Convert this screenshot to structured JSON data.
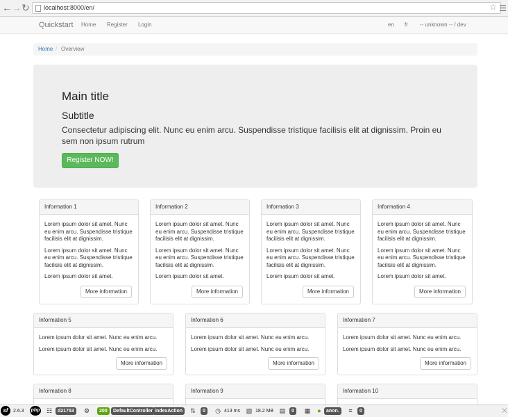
{
  "browser": {
    "url": "localhost:8000/en/"
  },
  "navbar": {
    "brand": "Quickstart",
    "links": [
      "Home",
      "Register",
      "Login"
    ],
    "lang_en": "en",
    "lang_fr": "fr",
    "user_info": "-- unknown -- / dev"
  },
  "breadcrumb": {
    "home": "Home",
    "separator": "/",
    "current": "Overview"
  },
  "jumbotron": {
    "title": "Main title",
    "subtitle": "Subtitle",
    "lead": "Consectetur adipiscing elit. Nunc eu enim arcu. Suspendisse tristique facilisis elit at dignissim. Proin eu sem non ipsum rutrum",
    "button": "Register NOW!"
  },
  "panels": [
    {
      "title": "Information 1",
      "paragraphs": [
        "Lorem ipsum dolor sit amet. Nunc eu enim arcu. Suspendisse tristique facilisis elit at dignissim.",
        "Lorem ipsum dolor sit amet. Nunc eu enim arcu. Suspendisse tristique facilisis elit at dignissim.",
        "Lorem ipsum dolor sit amet."
      ],
      "button": "More information"
    },
    {
      "title": "Information 2",
      "paragraphs": [
        "Lorem ipsum dolor sit amet. Nunc eu enim arcu. Suspendisse tristique facilisis elit at dignissim.",
        "Lorem ipsum dolor sit amet. Nunc eu enim arcu. Suspendisse tristique facilisis elit at dignissim.",
        "Lorem ipsum dolor sit amet."
      ],
      "button": "More information"
    },
    {
      "title": "Information 3",
      "paragraphs": [
        "Lorem ipsum dolor sit amet. Nunc eu enim arcu. Suspendisse tristique facilisis elit at dignissim.",
        "Lorem ipsum dolor sit amet. Nunc eu enim arcu. Suspendisse tristique facilisis elit at dignissim.",
        "Lorem ipsum dolor sit amet."
      ],
      "button": "More information"
    },
    {
      "title": "Information 4",
      "paragraphs": [
        "Lorem ipsum dolor sit amet. Nunc eu enim arcu. Suspendisse tristique facilisis elit at dignissim.",
        "Lorem ipsum dolor sit amet. Nunc eu enim arcu. Suspendisse tristique facilisis elit at dignissim.",
        "Lorem ipsum dolor sit amet."
      ],
      "button": "More information"
    },
    {
      "title": "Information 5",
      "paragraphs": [
        "Lorem ipsum dolor sit amet. Nunc eu enim arcu.",
        "Lorem ipsum dolor sit amet. Nunc eu enim arcu."
      ],
      "button": "More information"
    },
    {
      "title": "Information 6",
      "paragraphs": [
        "Lorem ipsum dolor sit amet. Nunc eu enim arcu.",
        "Lorem ipsum dolor sit amet. Nunc eu enim arcu."
      ],
      "button": "More information"
    },
    {
      "title": "Information 7",
      "paragraphs": [
        "Lorem ipsum dolor sit amet. Nunc eu enim arcu.",
        "Lorem ipsum dolor sit amet. Nunc eu enim arcu."
      ],
      "button": "More information"
    },
    {
      "title": "Information 8",
      "paragraphs": [],
      "button": ""
    },
    {
      "title": "Information 9",
      "paragraphs": [],
      "button": ""
    },
    {
      "title": "Information 10",
      "paragraphs": [],
      "button": ""
    }
  ],
  "toolbar": {
    "version": "2.6.3",
    "php_label": "php",
    "token": "d21753",
    "status": "200",
    "controller": "DefaultController",
    "action": "indexAction",
    "requests": "0",
    "time": "413 ms",
    "memory": "18.2 MB",
    "forms": "0",
    "user": "anon.",
    "logs": "0"
  }
}
